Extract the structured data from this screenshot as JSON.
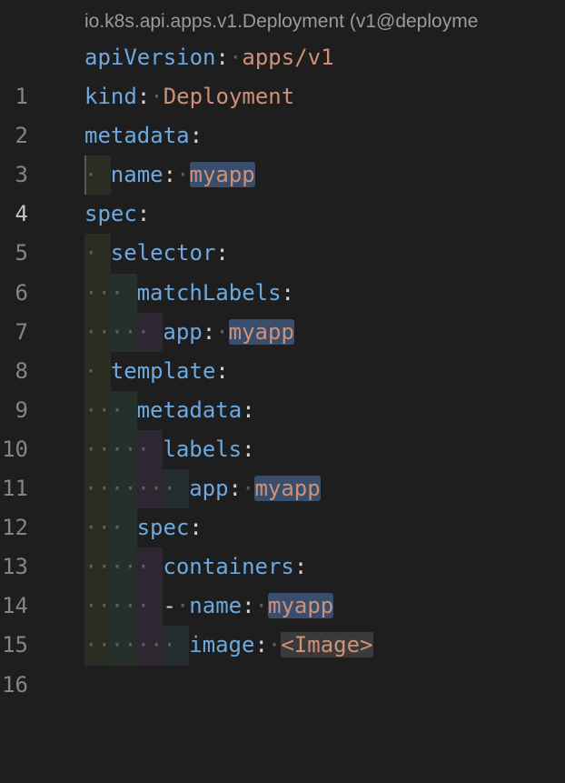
{
  "codelens": {
    "text": "io.k8s.api.apps.v1.Deployment (v1@deployme"
  },
  "editor": {
    "active_line": 4,
    "lines": [
      {
        "num": "1",
        "key": "apiVersion",
        "value": "apps/v1"
      },
      {
        "num": "2",
        "key": "kind",
        "value": "Deployment"
      },
      {
        "num": "3",
        "key": "metadata"
      },
      {
        "num": "4",
        "key": "name",
        "value": "myapp"
      },
      {
        "num": "5",
        "key": "spec"
      },
      {
        "num": "6",
        "key": "selector"
      },
      {
        "num": "7",
        "key": "matchLabels"
      },
      {
        "num": "8",
        "key": "app",
        "value": "myapp"
      },
      {
        "num": "9",
        "key": "template"
      },
      {
        "num": "10",
        "key": "metadata"
      },
      {
        "num": "11",
        "key": "labels"
      },
      {
        "num": "12",
        "key": "app",
        "value": "myapp"
      },
      {
        "num": "13",
        "key": "spec"
      },
      {
        "num": "14",
        "key": "containers"
      },
      {
        "num": "15",
        "key": "name",
        "value": "myapp"
      },
      {
        "num": "16",
        "key": "image",
        "value": "<Image>"
      }
    ]
  },
  "colors": {
    "background": "#1e1e1e",
    "key": "#6da9e0",
    "string": "#ce9178",
    "highlight": "#394e6d"
  }
}
